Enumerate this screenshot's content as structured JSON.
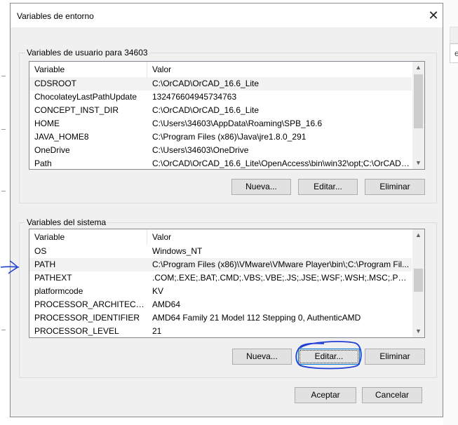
{
  "window": {
    "title": "Variables de entorno",
    "close_icon": "close-icon"
  },
  "user_section": {
    "label": "Variables de usuario para 34603",
    "columns": {
      "variable": "Variable",
      "value": "Valor"
    },
    "rows": [
      {
        "variable": "CDSROOT",
        "value": "C:\\OrCAD\\OrCAD_16.6_Lite"
      },
      {
        "variable": "ChocolateyLastPathUpdate",
        "value": "132476604945734763"
      },
      {
        "variable": "CONCEPT_INST_DIR",
        "value": "C:\\OrCAD\\OrCAD_16.6_Lite"
      },
      {
        "variable": "HOME",
        "value": "C:\\Users\\34603\\AppData\\Roaming\\SPB_16.6"
      },
      {
        "variable": "JAVA_HOME8",
        "value": "C:\\Program Files (x86)\\Java\\jre1.8.0_291"
      },
      {
        "variable": "OneDrive",
        "value": "C:\\Users\\34603\\OneDrive"
      },
      {
        "variable": "Path",
        "value": "C:\\OrCAD\\OrCAD_16.6_Lite\\OpenAccess\\bin\\win32\\opt;C:\\OrCAD\\..."
      }
    ],
    "buttons": {
      "new": "Nueva...",
      "edit": "Editar...",
      "delete": "Eliminar"
    }
  },
  "system_section": {
    "label": "Variables del sistema",
    "columns": {
      "variable": "Variable",
      "value": "Valor"
    },
    "rows": [
      {
        "variable": "OS",
        "value": "Windows_NT"
      },
      {
        "variable": "PATH",
        "value": "C:\\Program Files (x86)\\VMware\\VMware Player\\bin\\;C:\\Program Fil..."
      },
      {
        "variable": "PATHEXT",
        "value": ".COM;.EXE;.BAT;.CMD;.VBS;.VBE;.JS;.JSE;.WSF;.WSH;.MSC;.PY;.PYW"
      },
      {
        "variable": "platformcode",
        "value": "KV"
      },
      {
        "variable": "PROCESSOR_ARCHITECTURE",
        "value": "AMD64"
      },
      {
        "variable": "PROCESSOR_IDENTIFIER",
        "value": "AMD64 Family 21 Model 112 Stepping 0, AuthenticAMD"
      },
      {
        "variable": "PROCESSOR_LEVEL",
        "value": "21"
      }
    ],
    "buttons": {
      "new": "Nueva...",
      "edit": "Editar...",
      "delete": "Eliminar"
    }
  },
  "footer": {
    "accept": "Aceptar",
    "cancel": "Cancelar"
  },
  "background": {
    "input_fragment": "e"
  },
  "colors": {
    "annotation": "#1f3fd6",
    "focus_border": "#0078d7",
    "selected_row": "#f2f2f2"
  }
}
